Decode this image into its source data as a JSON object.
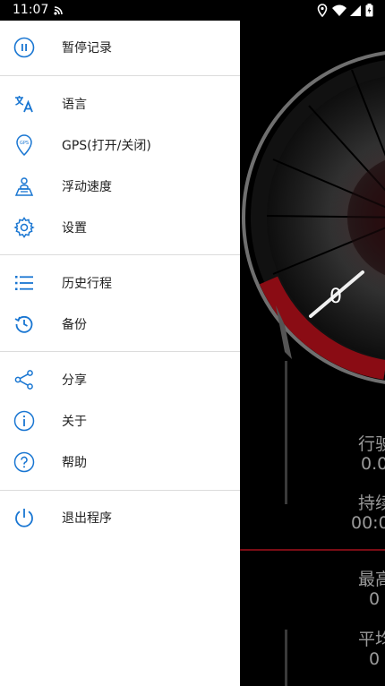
{
  "status_bar": {
    "time": "11:07"
  },
  "drawer": {
    "items": [
      {
        "label": "暂停记录",
        "icon": "pause-circle-icon"
      },
      {
        "label": "语言",
        "icon": "translate-icon"
      },
      {
        "label": "GPS(打开/关闭)",
        "icon": "gps-location-icon"
      },
      {
        "label": "浮动速度",
        "icon": "map-person-icon"
      },
      {
        "label": "设置",
        "icon": "gear-icon"
      },
      {
        "label": "历史行程",
        "icon": "list-icon"
      },
      {
        "label": "备份",
        "icon": "history-restore-icon"
      },
      {
        "label": "分享",
        "icon": "share-icon"
      },
      {
        "label": "关于",
        "icon": "info-icon"
      },
      {
        "label": "帮助",
        "icon": "help-icon"
      },
      {
        "label": "退出程序",
        "icon": "power-icon"
      }
    ],
    "accent_color": "#1976D2"
  },
  "speedometer": {
    "speed": "0",
    "stats": [
      {
        "label": "行驶",
        "value": "0.0"
      },
      {
        "label": "持续",
        "value": "00:0"
      },
      {
        "label": "最高",
        "value": "0"
      },
      {
        "label": "平均",
        "value": "0"
      }
    ]
  }
}
